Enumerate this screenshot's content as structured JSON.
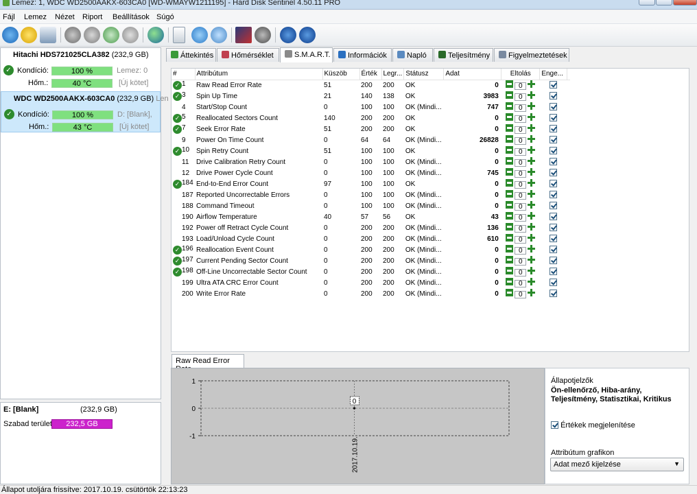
{
  "window": {
    "title": "Lemez: 1, WDC WD2500AAKX-603CA0 [WD-WMAYW1211195]  -  Hard Disk Sentinel 4.50.11 PRO"
  },
  "menu": [
    "Fájl",
    "Lemez",
    "Nézet",
    "Riport",
    "Beállítások",
    "Súgó"
  ],
  "toolbar_icons": [
    "refresh-icon",
    "warning-icon",
    "disk-window-icon",
    "wrench-icon",
    "wrench-gear-icon",
    "wrench-check-icon",
    "wrench-search-icon",
    "globe-icon",
    "document-icon",
    "sync-icon",
    "network-icon",
    "chart-icon",
    "speaker-icon",
    "help-icon",
    "info-icon"
  ],
  "disks": [
    {
      "name": "Hitachi HDS721025CLA382",
      "size": "(232,9 GB)",
      "condition_label": "Kondíció:",
      "condition": "100 %",
      "condition_pct": 100,
      "condition_note": "Lemez: 0",
      "temp_label": "Hőm.:",
      "temp": "40 °C",
      "temp_note": "[Új kötet]"
    },
    {
      "name": "WDC WD2500AAKX-603CA0",
      "size": "(232,9 GB)",
      "extra": "Len",
      "condition_label": "Kondíció:",
      "condition": "100 %",
      "condition_pct": 100,
      "condition_note": "D: [Blank],",
      "temp_label": "Hőm.:",
      "temp": "43 °C",
      "temp_note": "[Új kötet]"
    }
  ],
  "volume": {
    "name": "E: [Blank]",
    "size": "(232,9 GB)",
    "free_label": "Szabad terület",
    "free": "232,5 GB",
    "free_pct": 100
  },
  "tabs": [
    {
      "label": "Áttekintés",
      "icon": "overview-icon",
      "color": "#3a9a3a"
    },
    {
      "label": "Hőmérséklet",
      "icon": "thermometer-icon",
      "color": "#c04050"
    },
    {
      "label": "S.M.A.R.T.",
      "icon": "smart-icon",
      "color": "#8a8a8a",
      "active": true
    },
    {
      "label": "Információk",
      "icon": "info-icon",
      "color": "#2a6fc0"
    },
    {
      "label": "Napló",
      "icon": "log-icon",
      "color": "#5a8ac0"
    },
    {
      "label": "Teljesítmény",
      "icon": "performance-icon",
      "color": "#2a6a2a"
    },
    {
      "label": "Figyelmeztetések",
      "icon": "alerts-icon",
      "color": "#7a8aa0"
    }
  ],
  "smart_headers": [
    "#",
    "Attribútum",
    "Küszöb",
    "Érték",
    "Legr...",
    "Státusz",
    "Adat",
    "Eltolás",
    "Enge..."
  ],
  "smart_rows": [
    {
      "ok": true,
      "id": "1",
      "attr": "Raw Read Error Rate",
      "thr": "51",
      "val": "200",
      "worst": "200",
      "status": "OK",
      "data": "0",
      "offset": "0"
    },
    {
      "ok": true,
      "id": "3",
      "attr": "Spin Up Time",
      "thr": "21",
      "val": "140",
      "worst": "138",
      "status": "OK",
      "data": "3983",
      "offset": "0"
    },
    {
      "ok": false,
      "id": "4",
      "attr": "Start/Stop Count",
      "thr": "0",
      "val": "100",
      "worst": "100",
      "status": "OK (Mindi...",
      "data": "747",
      "offset": "0"
    },
    {
      "ok": true,
      "id": "5",
      "attr": "Reallocated Sectors Count",
      "thr": "140",
      "val": "200",
      "worst": "200",
      "status": "OK",
      "data": "0",
      "offset": "0"
    },
    {
      "ok": true,
      "id": "7",
      "attr": "Seek Error Rate",
      "thr": "51",
      "val": "200",
      "worst": "200",
      "status": "OK",
      "data": "0",
      "offset": "0"
    },
    {
      "ok": false,
      "id": "9",
      "attr": "Power On Time Count",
      "thr": "0",
      "val": "64",
      "worst": "64",
      "status": "OK (Mindi...",
      "data": "26828",
      "offset": "0"
    },
    {
      "ok": true,
      "id": "10",
      "attr": "Spin Retry Count",
      "thr": "51",
      "val": "100",
      "worst": "100",
      "status": "OK",
      "data": "0",
      "offset": "0"
    },
    {
      "ok": false,
      "id": "11",
      "attr": "Drive Calibration Retry Count",
      "thr": "0",
      "val": "100",
      "worst": "100",
      "status": "OK (Mindi...",
      "data": "0",
      "offset": "0"
    },
    {
      "ok": false,
      "id": "12",
      "attr": "Drive Power Cycle Count",
      "thr": "0",
      "val": "100",
      "worst": "100",
      "status": "OK (Mindi...",
      "data": "745",
      "offset": "0"
    },
    {
      "ok": true,
      "id": "184",
      "attr": "End-to-End Error Count",
      "thr": "97",
      "val": "100",
      "worst": "100",
      "status": "OK",
      "data": "0",
      "offset": "0"
    },
    {
      "ok": false,
      "id": "187",
      "attr": "Reported Uncorrectable Errors",
      "thr": "0",
      "val": "100",
      "worst": "100",
      "status": "OK (Mindi...",
      "data": "0",
      "offset": "0"
    },
    {
      "ok": false,
      "id": "188",
      "attr": "Command Timeout",
      "thr": "0",
      "val": "100",
      "worst": "100",
      "status": "OK (Mindi...",
      "data": "0",
      "offset": "0"
    },
    {
      "ok": false,
      "id": "190",
      "attr": "Airflow Temperature",
      "thr": "40",
      "val": "57",
      "worst": "56",
      "status": "OK",
      "data": "43",
      "offset": "0"
    },
    {
      "ok": false,
      "id": "192",
      "attr": "Power off Retract Cycle Count",
      "thr": "0",
      "val": "200",
      "worst": "200",
      "status": "OK (Mindi...",
      "data": "136",
      "offset": "0"
    },
    {
      "ok": false,
      "id": "193",
      "attr": "Load/Unload Cycle Count",
      "thr": "0",
      "val": "200",
      "worst": "200",
      "status": "OK (Mindi...",
      "data": "610",
      "offset": "0"
    },
    {
      "ok": true,
      "id": "196",
      "attr": "Reallocation Event Count",
      "thr": "0",
      "val": "200",
      "worst": "200",
      "status": "OK (Mindi...",
      "data": "0",
      "offset": "0"
    },
    {
      "ok": true,
      "id": "197",
      "attr": "Current Pending Sector Count",
      "thr": "0",
      "val": "200",
      "worst": "200",
      "status": "OK (Mindi...",
      "data": "0",
      "offset": "0"
    },
    {
      "ok": true,
      "id": "198",
      "attr": "Off-Line Uncorrectable Sector Count",
      "thr": "0",
      "val": "200",
      "worst": "200",
      "status": "OK (Mindi...",
      "data": "0",
      "offset": "0"
    },
    {
      "ok": false,
      "id": "199",
      "attr": "Ultra ATA CRC Error Count",
      "thr": "0",
      "val": "200",
      "worst": "200",
      "status": "OK (Mindi...",
      "data": "0",
      "offset": "0"
    },
    {
      "ok": false,
      "id": "200",
      "attr": "Write Error Rate",
      "thr": "0",
      "val": "200",
      "worst": "200",
      "status": "OK (Mindi...",
      "data": "0",
      "offset": "0"
    }
  ],
  "graph": {
    "tab_label": "Raw Read Error Rate",
    "chart_data": {
      "type": "line",
      "x": [
        "2017.10.19."
      ],
      "values": [
        0
      ],
      "ylim": [
        -1,
        1
      ],
      "yticks": [
        "1",
        "0",
        "-1"
      ],
      "point_label": "0"
    }
  },
  "legend_panel": {
    "title": "Állapotjelzők",
    "desc": "Ön-ellenőrző, Hiba-arány, Teljesítmény, Statisztikai, Kritikus",
    "show_values_label": "Értékek megjelenítése",
    "show_values_checked": true,
    "graph_label": "Attribútum grafikon",
    "graph_select": "Adat mező kijelzése"
  },
  "status_bar": "Állapot utoljára frissítve: 2017.10.19. csütörtök 22:13:23"
}
